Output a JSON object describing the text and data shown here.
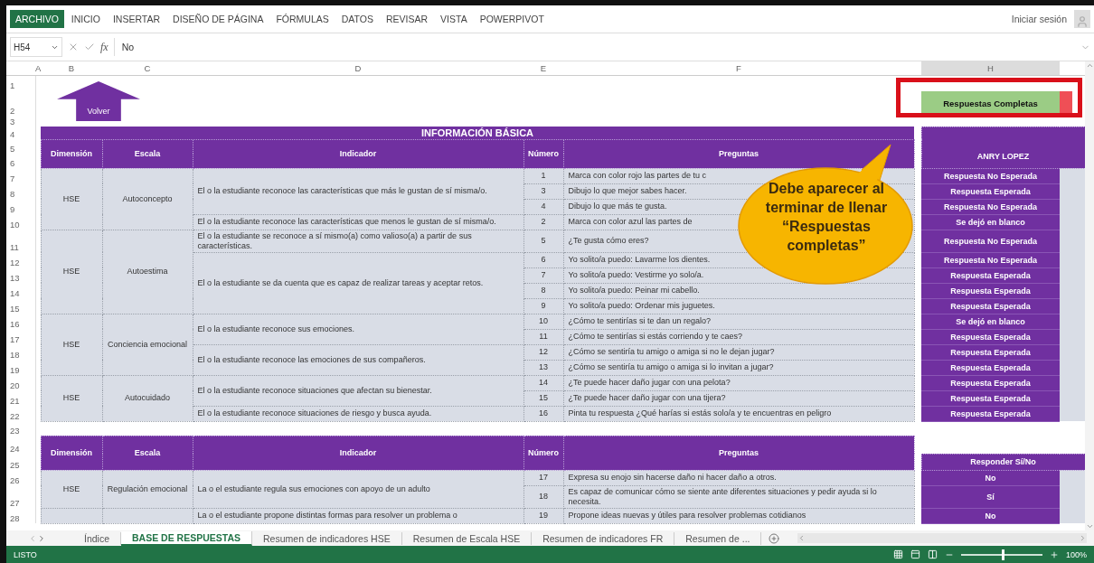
{
  "ribbon_tabs": [
    {
      "label": "ARCHIVO",
      "selected": true
    },
    {
      "label": "INICIO",
      "selected": false
    },
    {
      "label": "INSERTAR",
      "selected": false
    },
    {
      "label": "DISEÑO DE PÁGINA",
      "selected": false
    },
    {
      "label": "FÓRMULAS",
      "selected": false
    },
    {
      "label": "DATOS",
      "selected": false
    },
    {
      "label": "REVISAR",
      "selected": false
    },
    {
      "label": "VISTA",
      "selected": false
    },
    {
      "label": "POWERPIVOT",
      "selected": false
    }
  ],
  "sign_in": "Iniciar sesión",
  "name_box": "H54",
  "formula_icon": "fx",
  "formula": "No",
  "columns": [
    {
      "label": "A",
      "selected": false
    },
    {
      "label": "B",
      "selected": false
    },
    {
      "label": "C",
      "selected": false
    },
    {
      "label": "D",
      "selected": false
    },
    {
      "label": "E",
      "selected": false
    },
    {
      "label": "F",
      "selected": false
    },
    {
      "label": "H",
      "selected": true
    }
  ],
  "row_numbers": [
    "1",
    "2",
    "3",
    "4",
    "5",
    "6",
    "7",
    "8",
    "9",
    "10",
    "11",
    "12",
    "13",
    "14",
    "15",
    "16",
    "17",
    "18",
    "19",
    "20",
    "21",
    "22",
    "23",
    "24",
    "25",
    "26",
    "27",
    "28"
  ],
  "back_button": "Volver",
  "complete_button": "Respuestas Completas",
  "callout": "Debe aparecer al terminar de llenar “Respuestas completas”",
  "section_1": {
    "title": "INFORMACIÓN BÁSICA",
    "headers": [
      "Dimensión",
      "Escala",
      "Indicador",
      "Número",
      "Preguntas"
    ],
    "answer_header": "ANRY LOPEZ",
    "groups": [
      {
        "dimension": "HSE",
        "scale": "Autoconcepto",
        "indicators": [
          {
            "text": "El o la estudiante reconoce las características que más le gustan de sí misma/o.",
            "questions": [
              {
                "number": "1",
                "question": "Marca con color rojo las partes de tu c",
                "answer": "Respuesta No Esperada"
              },
              {
                "number": "3",
                "question": "Dibujo lo que mejor sabes hacer.",
                "answer": "Respuesta Esperada"
              },
              {
                "number": "4",
                "question": "Dibujo lo que más te gusta.",
                "answer": "Respuesta No Esperada"
              }
            ]
          },
          {
            "text": "El o la estudiante reconoce las características que menos le gustan de sí misma/o.",
            "questions": [
              {
                "number": "2",
                "question": "Marca con color azul las partes de",
                "answer": "Se dejó en blanco"
              }
            ]
          }
        ]
      },
      {
        "dimension": "HSE",
        "scale": "Autoestima",
        "indicators": [
          {
            "text": "El o la estudiante se reconoce a sí mismo(a) como valioso(a) a partir de sus características.",
            "questions": [
              {
                "number": "5",
                "question": "¿Te gusta cómo eres?",
                "answer": "Respuesta No Esperada"
              }
            ]
          },
          {
            "text": "El o la estudiante se da cuenta que es capaz de realizar tareas y aceptar retos.",
            "questions": [
              {
                "number": "6",
                "question": "Yo solito/a puedo: Lavarme los dientes.",
                "answer": "Respuesta No Esperada"
              },
              {
                "number": "7",
                "question": "Yo solito/a puedo: Vestirme yo solo/a.",
                "answer": "Respuesta Esperada"
              },
              {
                "number": "8",
                "question": "Yo solito/a puedo: Peinar mi cabello.",
                "answer": "Respuesta Esperada"
              },
              {
                "number": "9",
                "question": "Yo solito/a puedo: Ordenar mis juguetes.",
                "answer": "Respuesta Esperada"
              }
            ]
          }
        ]
      },
      {
        "dimension": "HSE",
        "scale": "Conciencia emocional",
        "indicators": [
          {
            "text": "El o la estudiante reconoce sus emociones.",
            "questions": [
              {
                "number": "10",
                "question": "¿Cómo te sentirías si te dan un regalo?",
                "answer": "Se dejó en blanco"
              },
              {
                "number": "11",
                "question": "¿Cómo te sentirías si estás corriendo y te caes?",
                "answer": "Respuesta Esperada"
              }
            ]
          },
          {
            "text": "El o la estudiante reconoce las emociones de sus compañeros.",
            "questions": [
              {
                "number": "12",
                "question": "¿Cómo se sentiría tu amigo o amiga si no le dejan jugar?",
                "answer": "Respuesta Esperada"
              },
              {
                "number": "13",
                "question": "¿Cómo se sentiría tu amigo o amiga si lo invitan a jugar?",
                "answer": "Respuesta Esperada"
              }
            ]
          }
        ]
      },
      {
        "dimension": "HSE",
        "scale": "Autocuidado",
        "indicators": [
          {
            "text": "El o la estudiante reconoce situaciones que afectan su bienestar.",
            "questions": [
              {
                "number": "14",
                "question": "¿Te puede hacer daño jugar con una pelota?",
                "answer": "Respuesta Esperada"
              },
              {
                "number": "15",
                "question": "¿Te puede hacer daño jugar con una tijera?",
                "answer": "Respuesta Esperada"
              }
            ]
          },
          {
            "text": "El o la estudiante reconoce situaciones de riesgo y busca ayuda.",
            "questions": [
              {
                "number": "16",
                "question": "Pinta tu respuesta ¿Qué harías si estás solo/a y te encuentras en peligro",
                "answer": "Respuesta Esperada"
              }
            ]
          }
        ]
      }
    ]
  },
  "section_2": {
    "headers": [
      "Dimensión",
      "Escala",
      "Indicador",
      "Número",
      "Preguntas"
    ],
    "answer_header": "Responder Sí/No",
    "groups": [
      {
        "dimension": "HSE",
        "scale": "Regulación emocional",
        "indicators": [
          {
            "text": "La o el estudiante regula sus emociones con apoyo de un adulto",
            "questions": [
              {
                "number": "17",
                "question": "Expresa su enojo sin hacerse daño ni hacer daño a otros.",
                "answer": "No"
              },
              {
                "number": "18",
                "question": "Es capaz de comunicar cómo se siente ante diferentes situaciones y pedir ayuda si lo necesita.",
                "answer": "Sí"
              }
            ]
          }
        ]
      },
      {
        "indicators": [
          {
            "text": "La o el estudiante propone distintas formas para resolver un problema o",
            "questions": [
              {
                "number": "19",
                "question": "Propone ideas nuevas y útiles para resolver problemas cotidianos",
                "answer": "No"
              }
            ]
          }
        ]
      }
    ]
  },
  "sheet_tabs": [
    {
      "label": "Índice",
      "selected": false
    },
    {
      "label": "BASE DE RESPUESTAS",
      "selected": true
    },
    {
      "label": "Resumen de indicadores HSE",
      "selected": false
    },
    {
      "label": "Resumen de Escala HSE",
      "selected": false
    },
    {
      "label": "Resumen de indicadores FR",
      "selected": false
    },
    {
      "label": "Resumen de ...",
      "selected": false
    }
  ],
  "status": "LISTO",
  "zoom": {
    "level": 0.5,
    "reading": "100%"
  }
}
